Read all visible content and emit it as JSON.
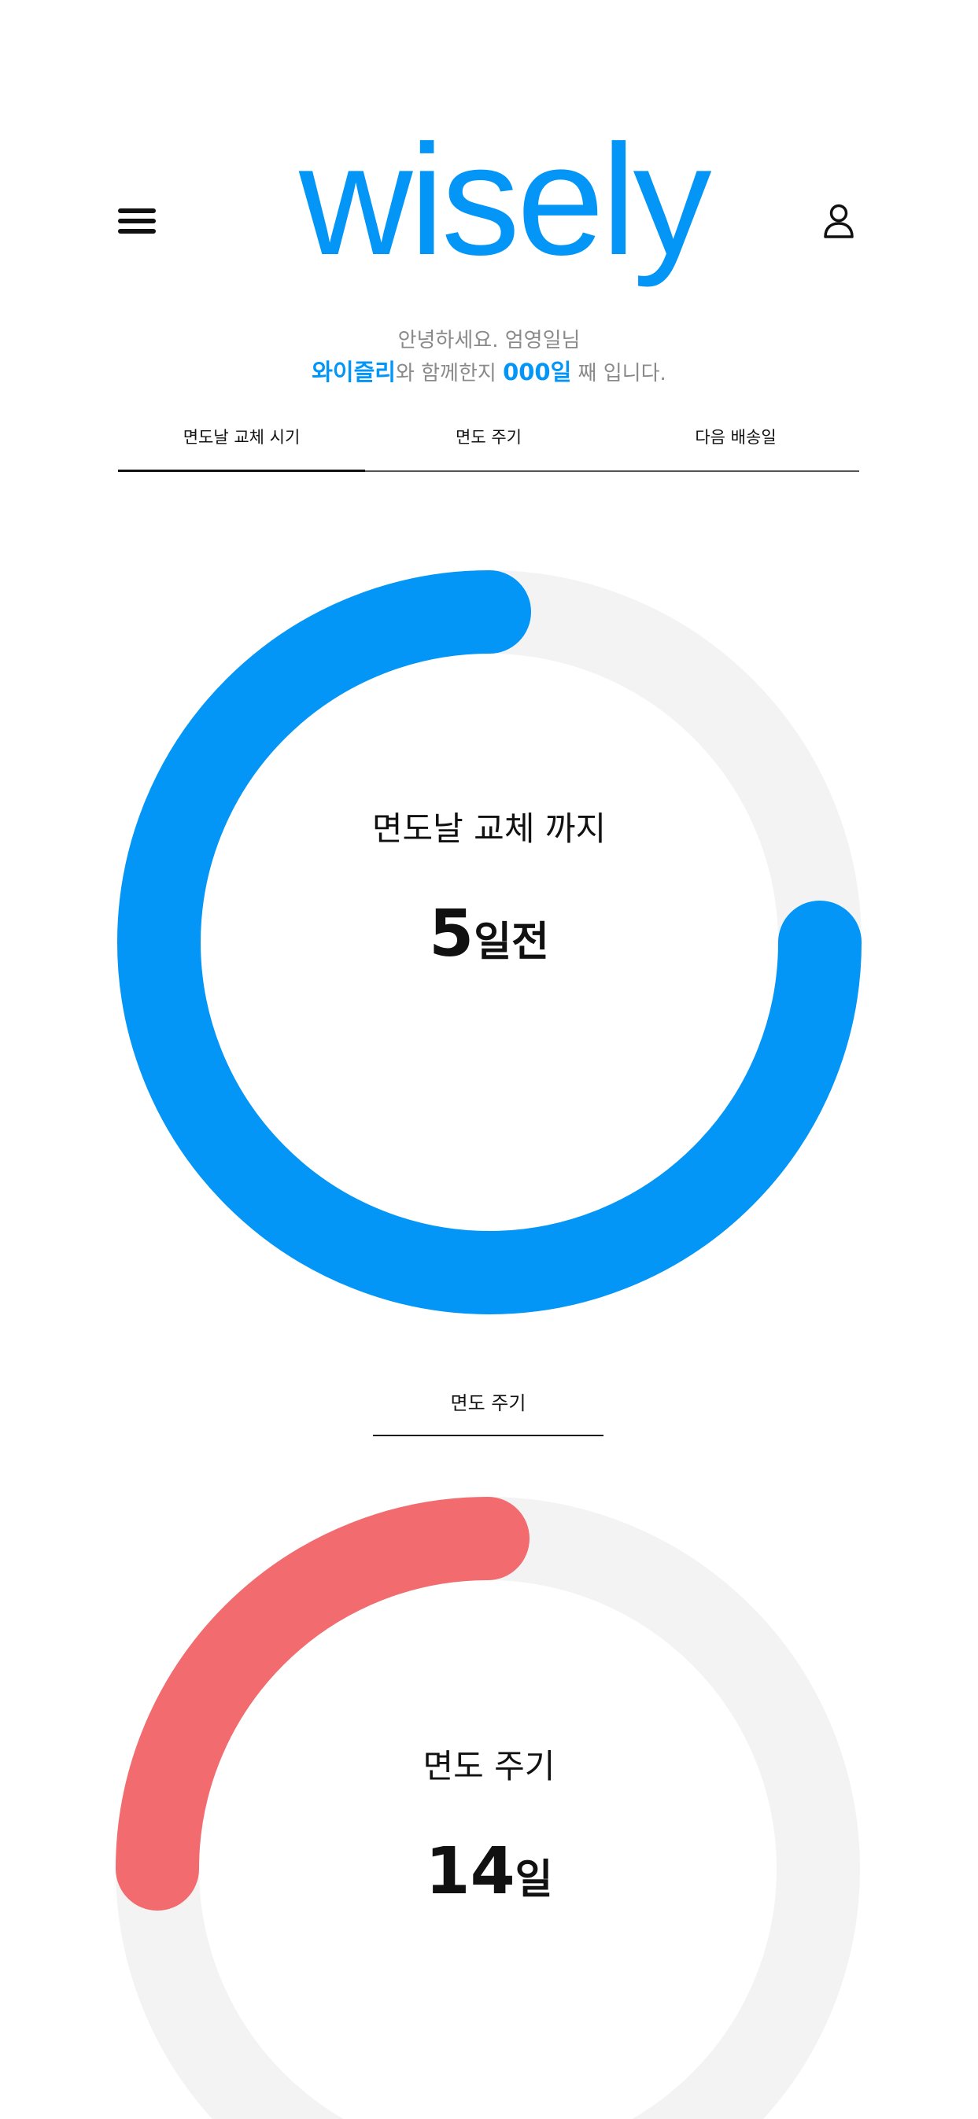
{
  "colors": {
    "brand": "#0396f7",
    "cycle_accent": "#f26b6e",
    "track": "#f3f3f3",
    "text_muted": "#8a8a8a"
  },
  "header": {
    "menu_icon": "hamburger-icon",
    "logo_text": "wisely",
    "profile_icon": "user-icon"
  },
  "greeting": {
    "line1": "안녕하세요. 엄영일님",
    "brand_name": "와이즐리",
    "middle": "와 함께한지 ",
    "days": "000일",
    "suffix": " 째 입니다."
  },
  "tabs": [
    {
      "label": "면도날 교체 시기",
      "active": true
    },
    {
      "label": "면도 주기",
      "active": false
    },
    {
      "label": "다음 배송일",
      "active": false
    }
  ],
  "blade_ring": {
    "title": "면도날 교체 까지",
    "value": "5",
    "unit": "일전",
    "progress": 0.75
  },
  "cycle_section": {
    "label": "면도 주기"
  },
  "cycle_ring": {
    "title": "면도 주기",
    "value": "14",
    "unit": "일",
    "progress": 0.25
  }
}
